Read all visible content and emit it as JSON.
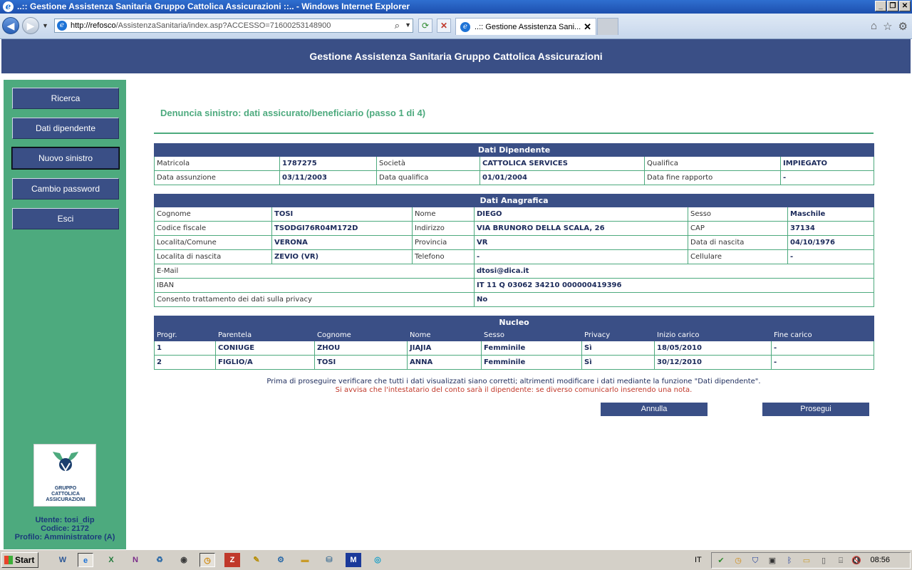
{
  "window": {
    "title": "..:: Gestione Assistenza Sanitaria Gruppo Cattolica Assicurazioni ::.. - Windows Internet Explorer"
  },
  "browser": {
    "url_host": "http://refosco",
    "url_path": "/AssistenzaSanitaria/index.asp?ACCESSO=71600253148900",
    "tab_title": "..:: Gestione Assistenza Sani...",
    "icons": [
      "back-icon",
      "forward-icon",
      "search-icon",
      "refresh-icon",
      "stop-icon",
      "home-icon",
      "favorites-icon",
      "tools-icon"
    ]
  },
  "app": {
    "header": "Gestione Assistenza Sanitaria Gruppo Cattolica Assicurazioni",
    "colors": {
      "primary": "#3a4f86",
      "accent": "#4daa7e",
      "warning": "#c0392b"
    }
  },
  "sidebar": {
    "items": [
      {
        "label": "Ricerca"
      },
      {
        "label": "Dati dipendente"
      },
      {
        "label": "Nuovo sinistro"
      },
      {
        "label": "Cambio password"
      },
      {
        "label": "Esci"
      }
    ],
    "active_item": "Nuovo sinistro",
    "logo_lines": [
      "GRUPPO",
      "CATTOLICA",
      "ASSICURAZIONI"
    ],
    "user": "Utente: tosi_dip",
    "code": "Codice: 2172",
    "profile": "Profilo: Amministratore (A)"
  },
  "main": {
    "title": "Denuncia sinistro: dati assicurato/beneficiario (passo 1 di 4)",
    "dipendente": {
      "section": "Dati Dipendente",
      "rows": [
        [
          "Matricola",
          "1787275",
          "Società",
          "CATTOLICA SERVICES",
          "Qualifica",
          "IMPIEGATO"
        ],
        [
          "Data assunzione",
          "03/11/2003",
          "Data qualifica",
          "01/01/2004",
          "Data fine rapporto",
          "-"
        ]
      ]
    },
    "anagrafica": {
      "section": "Dati Anagrafica",
      "rows": [
        [
          "Cognome",
          "TOSI",
          "Nome",
          "DIEGO",
          "Sesso",
          "Maschile"
        ],
        [
          "Codice fiscale",
          "TSODGI76R04M172D",
          "Indirizzo",
          "VIA BRUNORO DELLA SCALA, 26",
          "CAP",
          "37134"
        ],
        [
          "Localita/Comune",
          "VERONA",
          "Provincia",
          "VR",
          "Data di nascita",
          "04/10/1976"
        ],
        [
          "Localita di nascita",
          "ZEVIO  (VR)",
          "Telefono",
          "-",
          "Cellulare",
          "-"
        ]
      ],
      "wide_rows": [
        [
          "E-Mail",
          "dtosi@dica.it"
        ],
        [
          "IBAN",
          "IT 11 Q 03062 34210 000000419396"
        ],
        [
          "Consento trattamento dei dati sulla privacy",
          "No"
        ]
      ]
    },
    "nucleo": {
      "section": "Nucleo",
      "columns": [
        "Progr.",
        "Parentela",
        "Cognome",
        "Nome",
        "Sesso",
        "Privacy",
        "Inizio carico",
        "Fine carico"
      ],
      "rows": [
        [
          "1",
          "CONIUGE",
          "ZHOU",
          "JIAJIA",
          "Femminile",
          "Sì",
          "18/05/2010",
          "-"
        ],
        [
          "2",
          "FIGLIO/A",
          "TOSI",
          "ANNA",
          "Femminile",
          "Sì",
          "30/12/2010",
          "-"
        ]
      ]
    },
    "note_info": "Prima di proseguire verificare che tutti i dati visualizzati siano corretti; altrimenti modificare i dati mediante la funzione \"Dati dipendente\".",
    "note_warning": "Si avvisa che l'intestatario del conto sarà il dipendente: se diverso comunicarlo inserendo una nota.",
    "buttons": {
      "cancel": "Annulla",
      "next": "Prosegui"
    }
  },
  "taskbar": {
    "start_label": "Start",
    "language": "IT",
    "clock": "08:56"
  }
}
